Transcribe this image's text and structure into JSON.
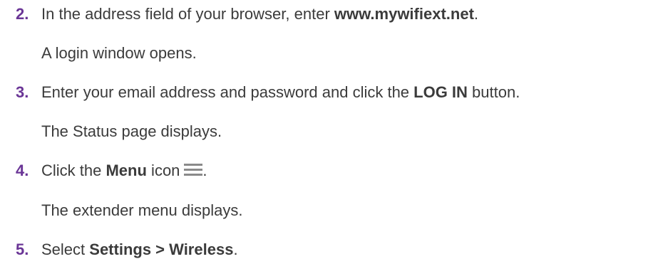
{
  "steps": [
    {
      "number": "2.",
      "pre": "In the address field of your browser, enter ",
      "bold": "www.mywifiext.net",
      "post": ".",
      "result": "A login window opens."
    },
    {
      "number": "3.",
      "pre": "Enter your email address and password and click the ",
      "bold": "LOG IN",
      "post": " button.",
      "result": "The Status page displays."
    },
    {
      "number": "4.",
      "pre": "Click the ",
      "bold": "Menu",
      "post": " icon",
      "icon": "hamburger-menu-icon",
      "after_icon": ".",
      "result": "The extender menu displays."
    },
    {
      "number": "5.",
      "pre": "Select ",
      "bold": "Settings > Wireless",
      "post": "."
    }
  ]
}
